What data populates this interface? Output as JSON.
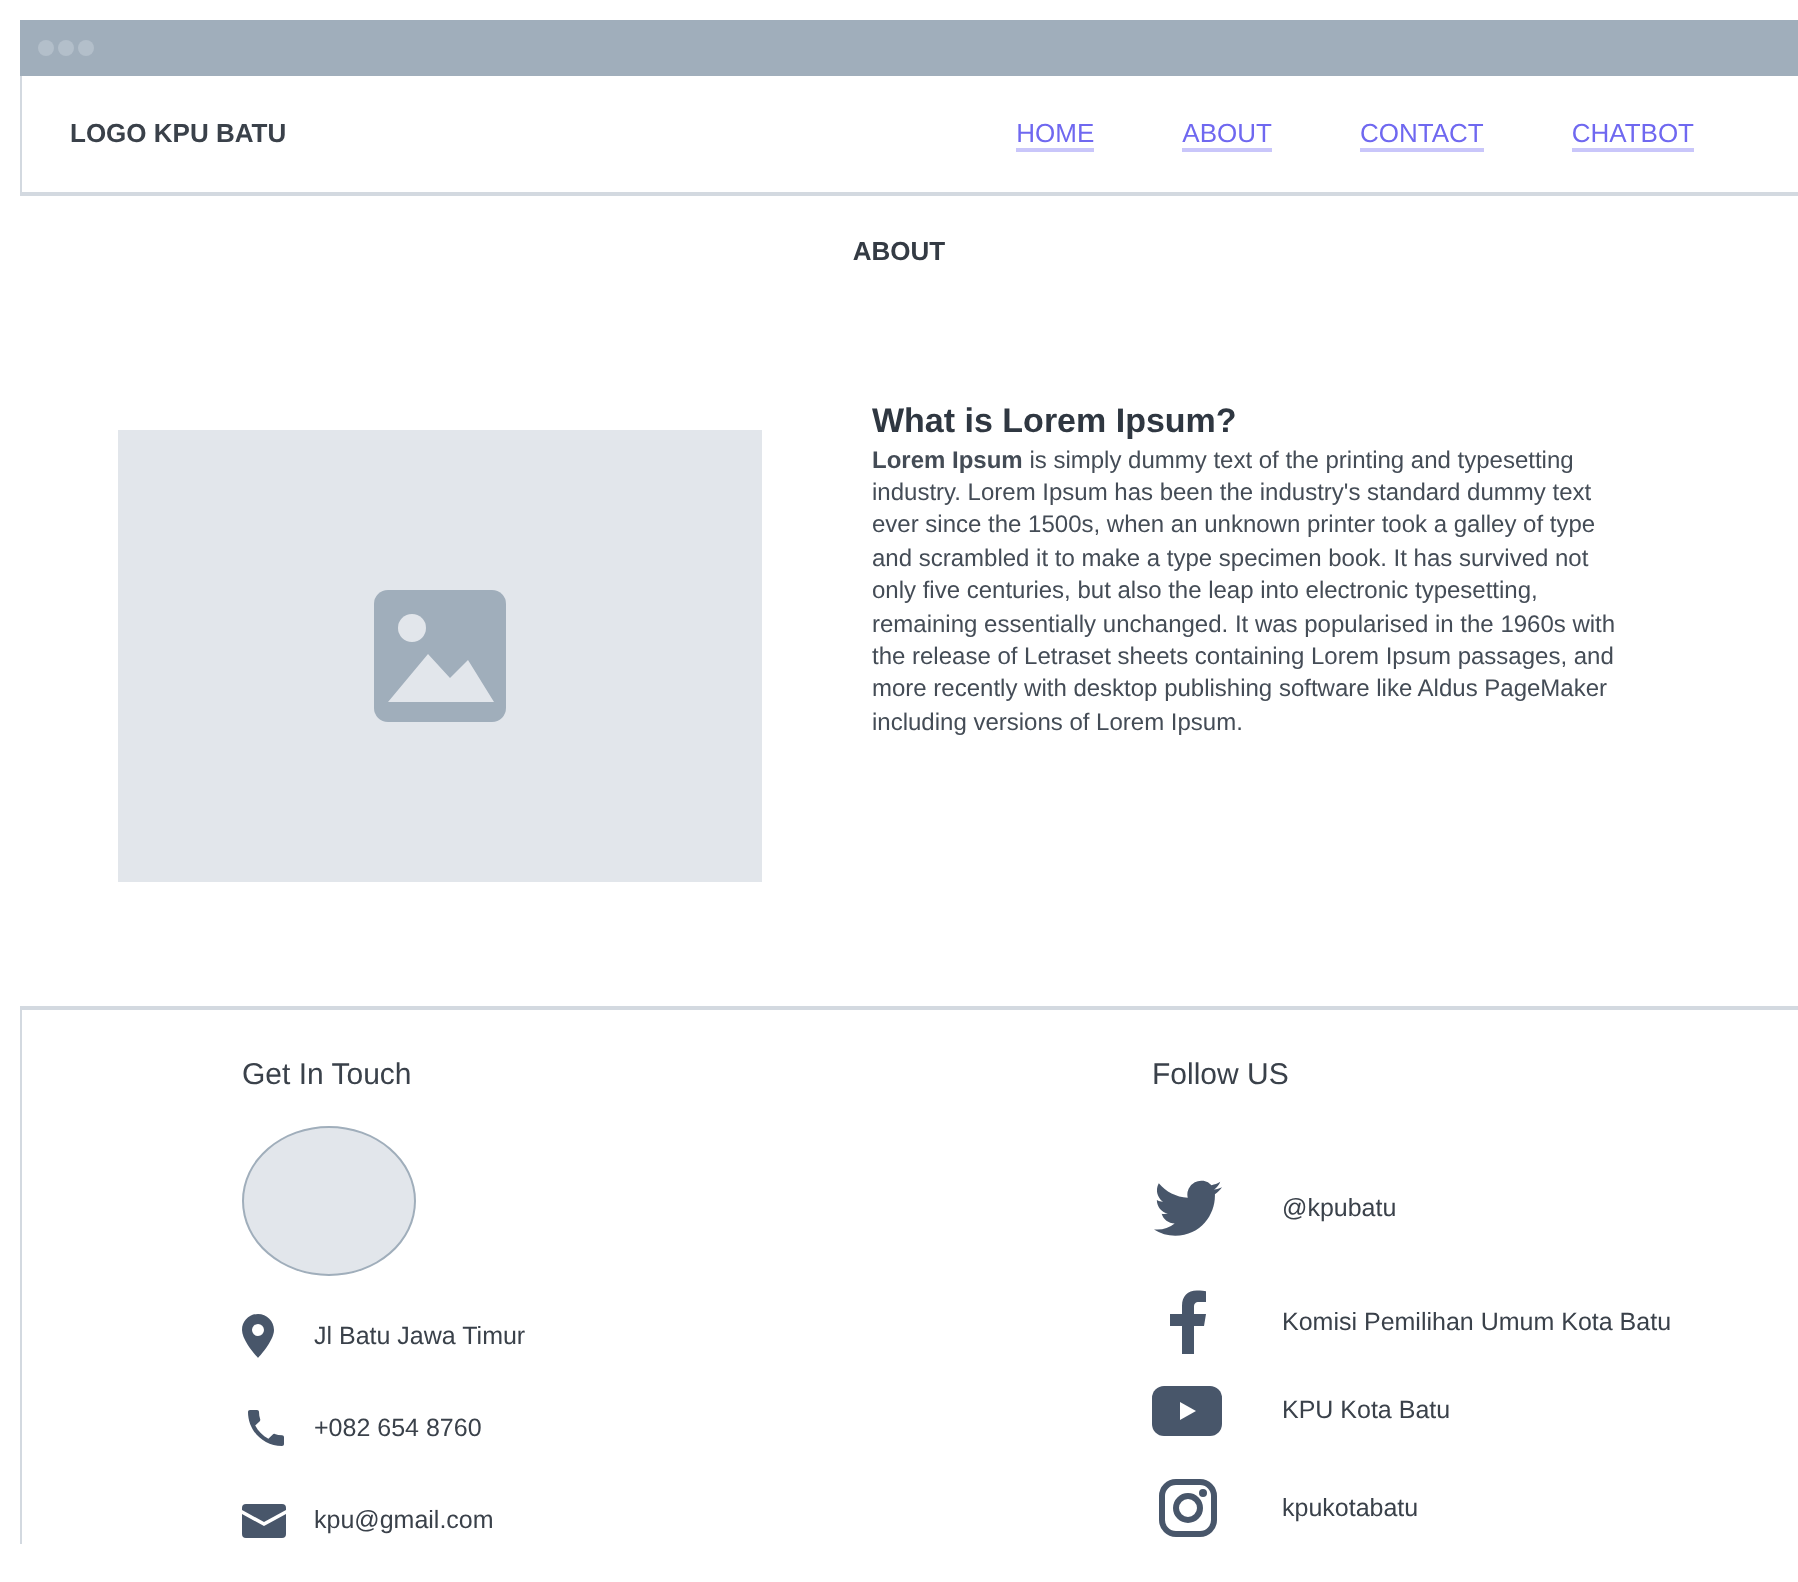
{
  "navbar": {
    "logo": "LOGO KPU BATU",
    "links": [
      {
        "label": "HOME"
      },
      {
        "label": "ABOUT"
      },
      {
        "label": "CONTACT"
      },
      {
        "label": "CHATBOT"
      }
    ]
  },
  "page_title": "ABOUT",
  "article": {
    "heading": "What is Lorem Ipsum?",
    "body": "**Lorem Ipsum** is simply dummy text of the printing and typesetting industry. Lorem Ipsum has been the industry's standard dummy text ever since the 1500s, when an unknown printer took a galley of type and scrambled it to make a type specimen book. It has survived not only five centuries, but also the leap into electronic typesetting, remaining essentially unchanged. It was popularised in the 1960s with the release of Letraset sheets containing Lorem Ipsum passages, and more recently with desktop publishing software like Aldus PageMaker including versions of Lorem Ipsum."
  },
  "footer": {
    "contact": {
      "title": "Get In Touch",
      "items": [
        {
          "kind": "location",
          "text": "Jl Batu Jawa Timur"
        },
        {
          "kind": "phone",
          "text": "+082 654 8760"
        },
        {
          "kind": "email",
          "text": "kpu@gmail.com"
        }
      ]
    },
    "social": {
      "title": "Follow US",
      "items": [
        {
          "kind": "twitter",
          "text": "@kpubatu"
        },
        {
          "kind": "facebook",
          "text": "Komisi Pemilihan Umum Kota Batu"
        },
        {
          "kind": "youtube",
          "text": "KPU Kota Batu"
        },
        {
          "kind": "instagram",
          "text": "kpukotabatu"
        }
      ]
    }
  }
}
